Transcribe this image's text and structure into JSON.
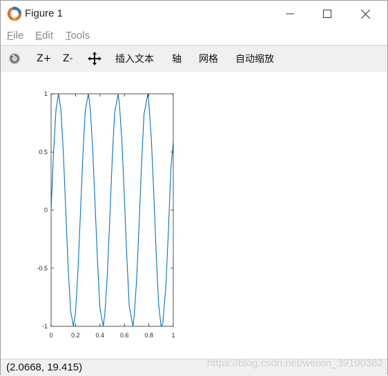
{
  "window": {
    "title": "Figure 1"
  },
  "menu": [
    {
      "mnemonic": "F",
      "rest": "ile"
    },
    {
      "mnemonic": "E",
      "rest": "dit"
    },
    {
      "mnemonic": "T",
      "rest": "ools"
    }
  ],
  "toolbar": {
    "zoom_in": "Z+",
    "zoom_out": "Z-",
    "insert_text": "插入文本",
    "axis": "轴",
    "grid": "网格",
    "autoscale": "自动缩放"
  },
  "status": {
    "coords": "(2.0668, 19.415)",
    "watermark": "https://blog.csdn.net/weixin_39190382"
  },
  "colors": {
    "line": "#0072bd",
    "toolbar_bg": "#f0f0f0"
  },
  "icons": [
    "octave-logo-icon",
    "minimize-icon",
    "maximize-icon",
    "close-icon",
    "rotate-icon",
    "pan-icon"
  ],
  "chart_data": {
    "type": "line",
    "function": "sin(2*pi*4.1*x)",
    "x_range": [
      0,
      1
    ],
    "xlim": [
      0,
      1
    ],
    "ylim": [
      -1,
      1
    ],
    "xticks": [
      "0",
      "0.2",
      "0.4",
      "0.6",
      "0.8",
      "1"
    ],
    "yticks": [
      "1",
      "0.5",
      "0",
      "-0.5",
      "-1"
    ],
    "series": [
      {
        "x": [
          0,
          0.02,
          0.04,
          0.061,
          0.08,
          0.1,
          0.12,
          0.14,
          0.16,
          0.183,
          0.2,
          0.22,
          0.24,
          0.26,
          0.28,
          0.305,
          0.32,
          0.34,
          0.36,
          0.38,
          0.4,
          0.427,
          0.44,
          0.46,
          0.48,
          0.5,
          0.52,
          0.549,
          0.56,
          0.58,
          0.6,
          0.62,
          0.64,
          0.67,
          0.68,
          0.7,
          0.72,
          0.74,
          0.76,
          0.792,
          0.8,
          0.82,
          0.84,
          0.86,
          0.88,
          0.9,
          0.914,
          0.94,
          0.96,
          0.98,
          1
        ],
        "y": [
          0,
          0.49,
          0.86,
          1,
          0.87,
          0.5,
          0.0,
          -0.5,
          -0.87,
          -1,
          -0.88,
          -0.52,
          -0.03,
          0.47,
          0.86,
          1,
          0.88,
          0.54,
          0.05,
          -0.45,
          -0.85,
          -1,
          -0.89,
          -0.56,
          -0.08,
          0.43,
          0.84,
          1,
          0.9,
          0.58,
          0.1,
          -0.41,
          -0.83,
          -1,
          -0.91,
          -0.6,
          -0.13,
          0.39,
          0.82,
          1,
          0.92,
          0.62,
          0.15,
          -0.37,
          -0.81,
          -1,
          -0.98,
          -0.64,
          -0.18,
          0.35,
          0.59
        ]
      }
    ]
  }
}
